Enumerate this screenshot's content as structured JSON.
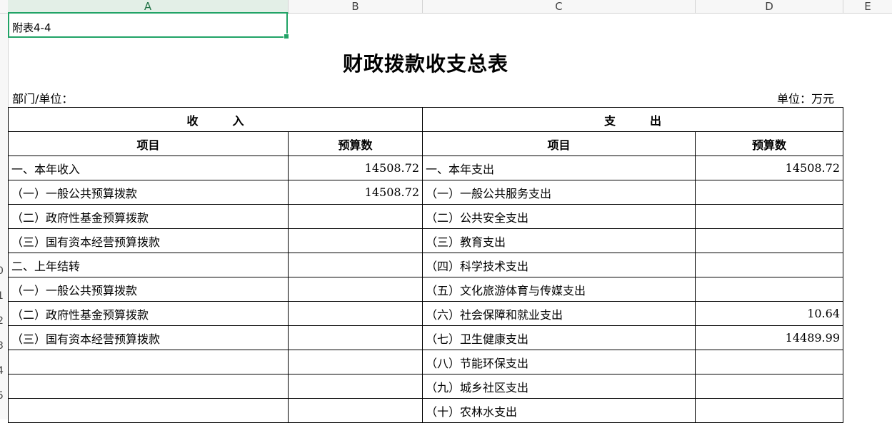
{
  "columns": [
    "A",
    "B",
    "C",
    "D",
    "E"
  ],
  "row_numbers": [
    "0",
    "1",
    "2",
    "3",
    "4",
    "5"
  ],
  "table_note": "附表4-4",
  "title": "财政拨款收支总表",
  "department_label": "部门/单位：",
  "unit_label": "单位：万元",
  "headers": {
    "income": "收　　　入",
    "expenditure": "支　　　出",
    "item": "项目",
    "budget": "预算数"
  },
  "rows": [
    {
      "income_item": "一、本年收入",
      "income_value": "14508.72",
      "exp_item": "一、本年支出",
      "exp_value": "14508.72"
    },
    {
      "income_item": "（一）一般公共预算拨款",
      "income_value": "14508.72",
      "exp_item": "（一）一般公共服务支出",
      "exp_value": ""
    },
    {
      "income_item": "（二）政府性基金预算拨款",
      "income_value": "",
      "exp_item": "（二）公共安全支出",
      "exp_value": ""
    },
    {
      "income_item": "（三）国有资本经营预算拨款",
      "income_value": "",
      "exp_item": "（三）教育支出",
      "exp_value": ""
    },
    {
      "income_item": "二、上年结转",
      "income_value": "",
      "exp_item": "（四）科学技术支出",
      "exp_value": ""
    },
    {
      "income_item": "（一）一般公共预算拨款",
      "income_value": "",
      "exp_item": "（五）文化旅游体育与传媒支出",
      "exp_value": ""
    },
    {
      "income_item": "（二）政府性基金预算拨款",
      "income_value": "",
      "exp_item": "（六）社会保障和就业支出",
      "exp_value": "10.64"
    },
    {
      "income_item": "（三）国有资本经营预算拨款",
      "income_value": "",
      "exp_item": "（七）卫生健康支出",
      "exp_value": "14489.99"
    },
    {
      "income_item": "",
      "income_value": "",
      "exp_item": "（八）节能环保支出",
      "exp_value": ""
    },
    {
      "income_item": "",
      "income_value": "",
      "exp_item": "（九）城乡社区支出",
      "exp_value": ""
    },
    {
      "income_item": "",
      "income_value": "",
      "exp_item": "（十）农林水支出",
      "exp_value": ""
    }
  ]
}
